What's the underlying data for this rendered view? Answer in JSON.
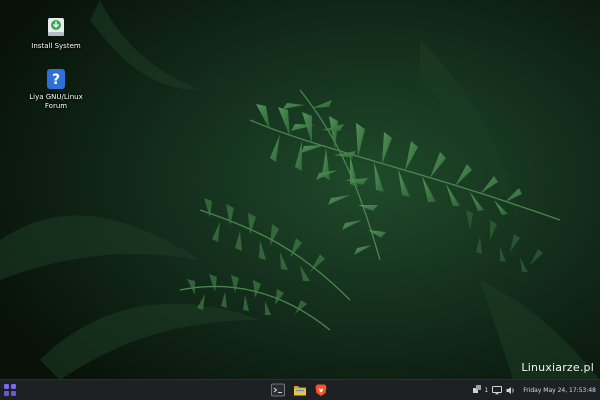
{
  "desktop": {
    "icons": [
      {
        "label": "Install System",
        "icon": "install-icon",
        "color": "#3aa655"
      },
      {
        "label": "Liya GNU/Linux\nForum",
        "icon": "help-question-icon",
        "color": "#2f6fd6"
      }
    ],
    "watermark": "Linuxiarze.pl"
  },
  "taskbar": {
    "app_menu_icon": "app-grid-icon",
    "accent": "#6a5acd",
    "tasks": [
      {
        "name": "Terminal",
        "icon": "terminal-icon"
      },
      {
        "name": "Files",
        "icon": "files-icon"
      },
      {
        "name": "Brave",
        "icon": "brave-icon"
      }
    ],
    "tray": {
      "network_badge": "1",
      "clock": "Friday May 24, 17:53:48"
    }
  }
}
